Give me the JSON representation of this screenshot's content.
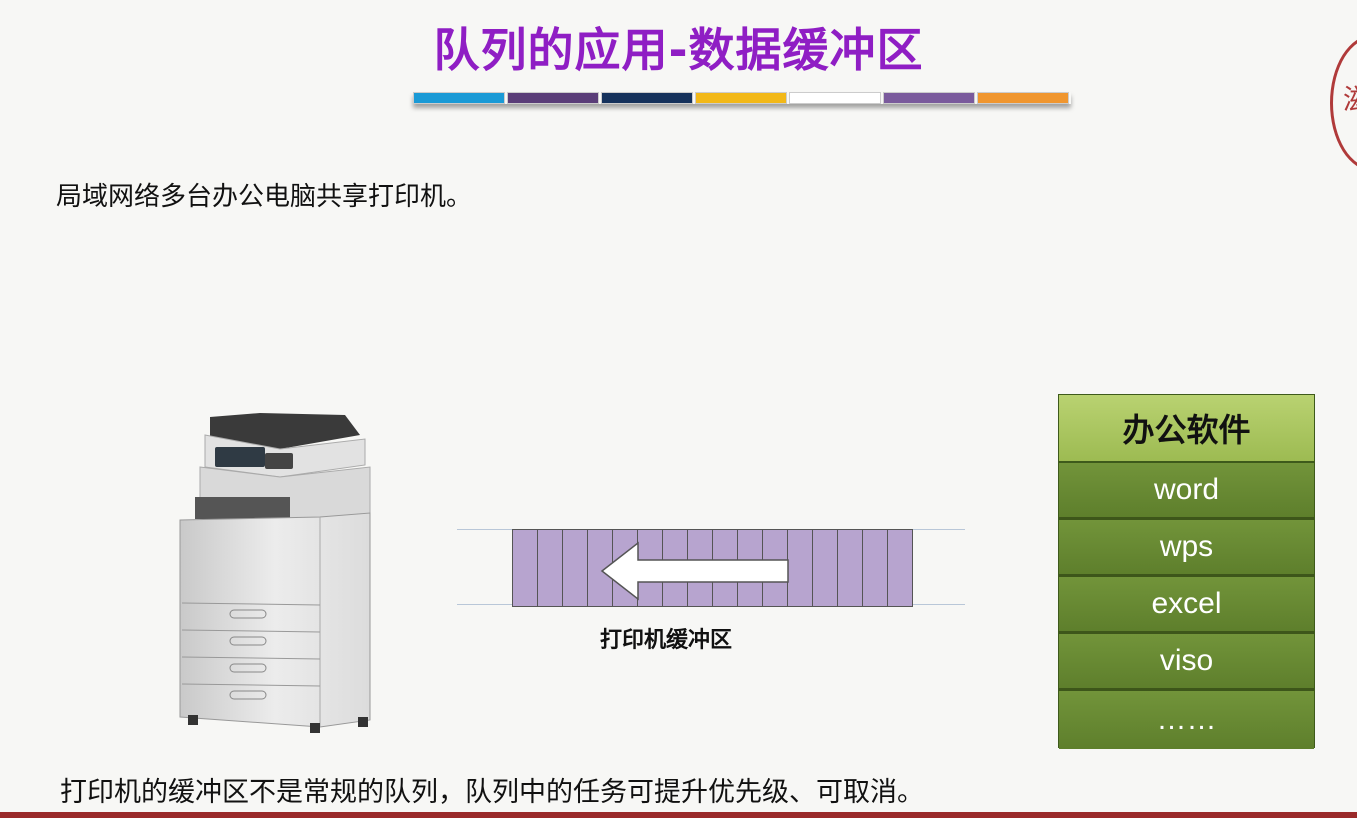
{
  "slide": {
    "title": "队列的应用-数据缓冲区",
    "title_bar_colors": [
      "#1a9ad6",
      "#5a3d78",
      "#16325c",
      "#f2b818",
      "#ffffff",
      "#7a5a9c",
      "#f0962f"
    ],
    "intro": "局域网络多台办公电脑共享打印机。",
    "footer": "打印机的缓冲区不是常规的队列，队列中的任务可提升优先级、可取消。",
    "seal_char": "滋"
  },
  "buffer": {
    "label": "打印机缓冲区",
    "cell_count": 16,
    "fill_color": "#b7a4cf",
    "arrow_direction": "left"
  },
  "software": {
    "header": "办公软件",
    "items": [
      "word",
      "wps",
      "excel",
      "viso",
      "……"
    ]
  },
  "icons": {
    "printer": "printer-copier-image",
    "seal": "red-seal-stamp"
  }
}
